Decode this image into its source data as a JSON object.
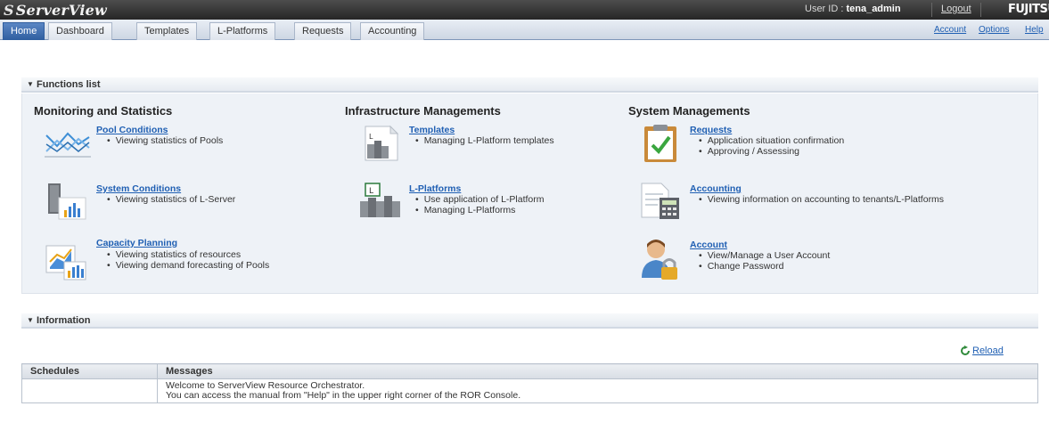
{
  "header": {
    "logo": "ServerView",
    "user_label": "User ID : ",
    "user_id": "tena_admin",
    "logout": "Logout",
    "brand": "FUJITSU"
  },
  "tabs": [
    {
      "label": "Home",
      "active": true
    },
    {
      "label": "Dashboard"
    },
    {
      "label": "Templates"
    },
    {
      "label": "L-Platforms"
    },
    {
      "label": "Requests"
    },
    {
      "label": "Accounting"
    }
  ],
  "toplinks": {
    "account": "Account",
    "options": "Options",
    "help": "Help"
  },
  "functions": {
    "title": "Functions list",
    "monitoring": {
      "title": "Monitoring and Statistics",
      "items": [
        {
          "link": "Pool Conditions",
          "bullets": [
            "Viewing statistics of Pools"
          ],
          "icon": "line-chart-icon"
        },
        {
          "link": "System Conditions",
          "bullets": [
            "Viewing statistics of L-Server"
          ],
          "icon": "server-bar-chart-icon"
        },
        {
          "link": "Capacity Planning",
          "bullets": [
            "Viewing statistics of resources",
            "Viewing demand forecasting of Pools"
          ],
          "icon": "capacity-chart-icon"
        }
      ]
    },
    "infrastructure": {
      "title": "Infrastructure Managements",
      "items": [
        {
          "link": "Templates",
          "bullets": [
            "Managing L-Platform templates"
          ],
          "icon": "template-icon"
        },
        {
          "link": "L-Platforms",
          "bullets": [
            "Use application of L-Platform",
            "Managing L-Platforms"
          ],
          "icon": "l-platform-icon"
        }
      ]
    },
    "system": {
      "title": "System Managements",
      "items": [
        {
          "link": "Requests",
          "bullets": [
            "Application situation confirmation",
            "Approving / Assessing"
          ],
          "icon": "clipboard-check-icon"
        },
        {
          "link": "Accounting",
          "bullets": [
            "Viewing information on accounting to tenants/L-Platforms"
          ],
          "icon": "calculator-document-icon"
        },
        {
          "link": "Account",
          "bullets": [
            "View/Manage a User Account",
            "Change Password"
          ],
          "icon": "user-lock-icon"
        }
      ]
    }
  },
  "information": {
    "title": "Information",
    "reload": "Reload",
    "columns": [
      "Schedules",
      "Messages"
    ],
    "rows": [
      {
        "schedule": "",
        "messages": [
          "Welcome to ServerView Resource Orchestrator.",
          "You can access the manual from \"Help\" in the upper right corner of the ROR Console."
        ]
      }
    ]
  },
  "colors": {
    "accent": "#2f5e9f",
    "link": "#1f5fb3",
    "panel": "#eef2f7"
  }
}
